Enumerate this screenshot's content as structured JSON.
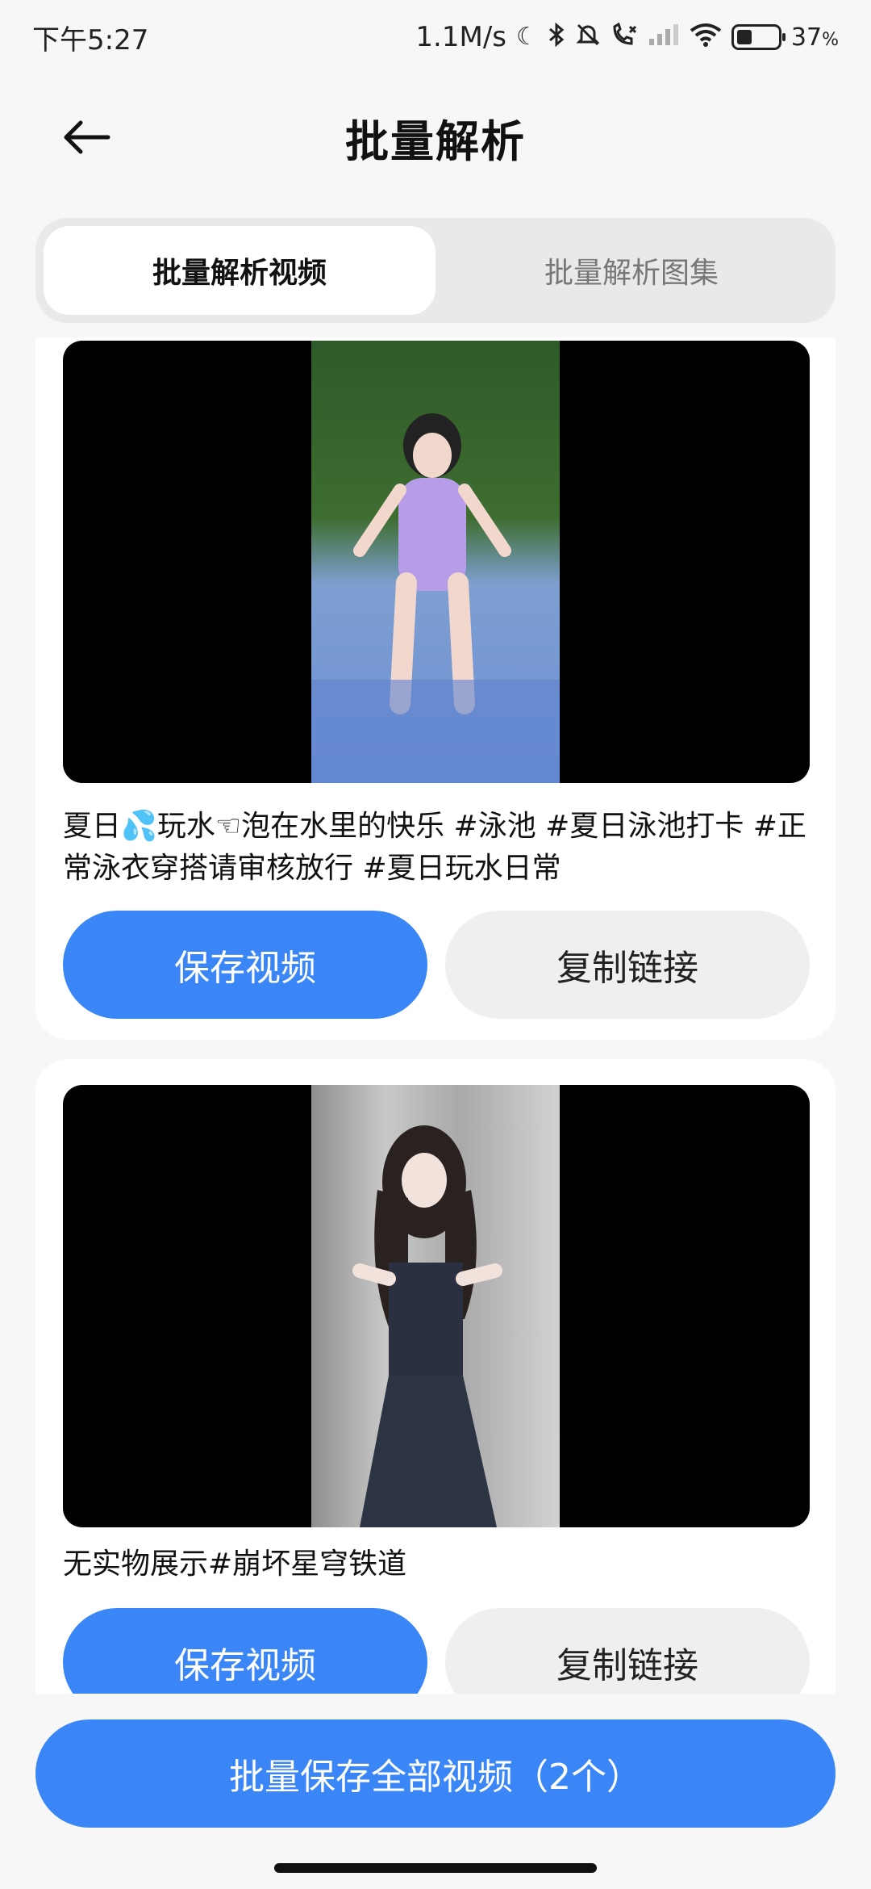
{
  "status_bar": {
    "time": "下午5:27",
    "speed": "1.1M/s",
    "battery_percent": "37",
    "battery_percent_suffix": "%",
    "battery_level": 0.37,
    "icons": [
      "moon-icon",
      "bluetooth-icon",
      "silent-bell-icon",
      "call-forward-icon",
      "signal-icon",
      "wifi-icon",
      "battery-icon"
    ]
  },
  "header": {
    "title": "批量解析",
    "back_icon": "arrow-left-icon"
  },
  "tabs": [
    {
      "label": "批量解析视频",
      "active": true
    },
    {
      "label": "批量解析图集",
      "active": false
    }
  ],
  "items": [
    {
      "caption": "夏日💦玩水☜泡在水里的快乐 #泳池 #夏日泳池打卡 #正常泳衣穿搭请审核放行 #夏日玩水日常",
      "save_label": "保存视频",
      "copy_label": "复制链接"
    },
    {
      "caption": "无实物展示#崩坏星穹铁道",
      "save_label": "保存视频",
      "copy_label": "复制链接"
    }
  ],
  "bottom": {
    "save_all_label": "批量保存全部视频（2个）"
  },
  "colors": {
    "accent": "#3a86f7",
    "background": "#f7f7f7",
    "card": "#ffffff"
  }
}
